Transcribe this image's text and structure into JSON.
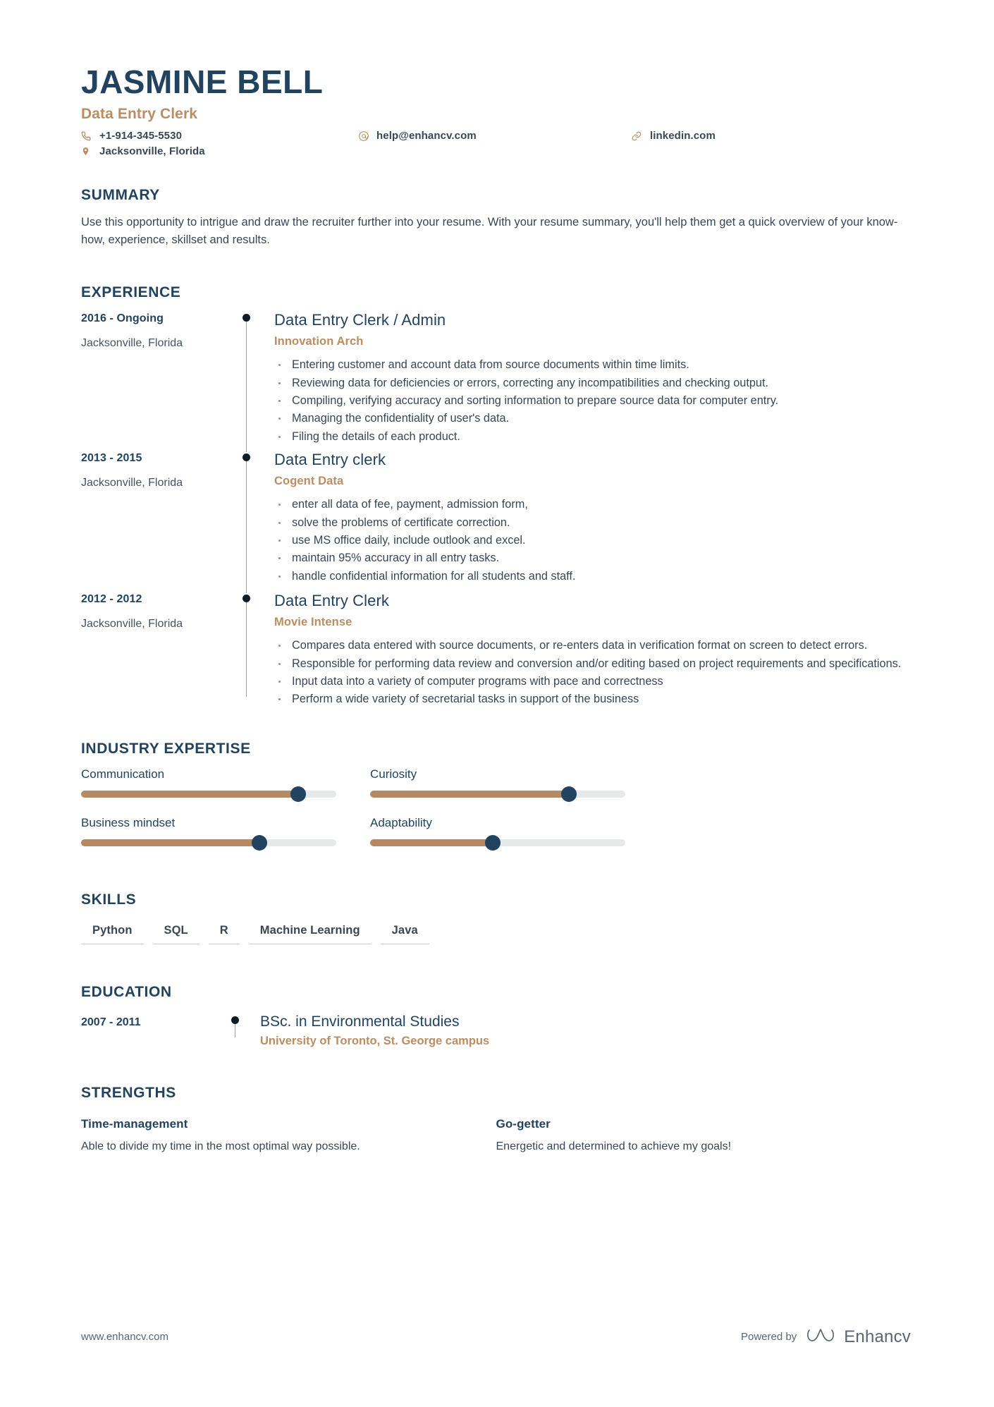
{
  "header": {
    "name": "JASMINE BELL",
    "job_title": "Data Entry Clerk",
    "contacts": [
      {
        "icon": "phone-icon",
        "value": "+1-914-345-5530"
      },
      {
        "icon": "email-icon",
        "value": "help@enhancv.com"
      },
      {
        "icon": "link-icon",
        "value": "linkedin.com"
      },
      {
        "icon": "location-pin-icon",
        "value": "Jacksonville, Florida"
      }
    ]
  },
  "summary": {
    "title": "SUMMARY",
    "text": "Use this opportunity to intrigue and draw the recruiter further into your resume. With your resume summary, you'll help them get a quick overview of your know-how, experience, skillset and results."
  },
  "experience": {
    "title": "EXPERIENCE",
    "entries": [
      {
        "dates": "2016 - Ongoing",
        "location": "Jacksonville, Florida",
        "role": "Data Entry Clerk / Admin",
        "company": "Innovation Arch",
        "bullets": [
          "Entering customer and account data from source documents within time limits.",
          "Reviewing data for deficiencies or errors, correcting any incompatibilities and checking output.",
          "Compiling, verifying accuracy and sorting information to prepare source data for computer entry.",
          "Managing the confidentiality of user's data.",
          "Filing the details of each product."
        ]
      },
      {
        "dates": "2013 - 2015",
        "location": "Jacksonville, Florida",
        "role": "Data Entry clerk",
        "company": "Cogent Data",
        "bullets": [
          "enter all data of fee, payment, admission form,",
          "solve the problems of certificate correction.",
          "use MS office daily, include outlook and excel.",
          "maintain 95% accuracy in all entry tasks.",
          "handle confidential information for all students and staff."
        ]
      },
      {
        "dates": "2012 - 2012",
        "location": "Jacksonville, Florida",
        "role": "Data Entry Clerk",
        "company": "Movie Intense",
        "bullets": [
          "Compares data entered with source documents, or re-enters data in verification format on screen to detect errors.",
          "Responsible for performing data review and conversion and/or editing based on project requirements and specifications.",
          "Input data into a variety of computer programs with pace and correctness",
          "Perform a wide variety of secretarial tasks in support of the business"
        ]
      }
    ]
  },
  "industry_expertise": {
    "title": "INDUSTRY EXPERTISE",
    "items": [
      {
        "label": "Communication",
        "percent": 85
      },
      {
        "label": "Curiosity",
        "percent": 78
      },
      {
        "label": "Business mindset",
        "percent": 70
      },
      {
        "label": "Adaptability",
        "percent": 58
      }
    ]
  },
  "skills": {
    "title": "SKILLS",
    "items": [
      "Python",
      "SQL",
      "R",
      "Machine Learning",
      "Java"
    ]
  },
  "education": {
    "title": "EDUCATION",
    "entries": [
      {
        "dates": "2007 - 2011",
        "degree": "BSc. in Environmental Studies",
        "school": "University of Toronto, St. George campus"
      }
    ]
  },
  "strengths": {
    "title": "STRENGTHS",
    "items": [
      {
        "title": "Time-management",
        "description": "Able to divide my time in the most optimal way possible."
      },
      {
        "title": "Go-getter",
        "description": "Energetic and determined to achieve my goals!"
      }
    ]
  },
  "footer": {
    "url": "www.enhancv.com",
    "powered_by": "Powered by",
    "brand": "Enhancv"
  },
  "colors": {
    "navy": "#22435f",
    "accent": "#bb8d63",
    "slider_fill": "#b58a62",
    "slider_track": "#e7e8e8",
    "body_text": "#3b4653"
  }
}
